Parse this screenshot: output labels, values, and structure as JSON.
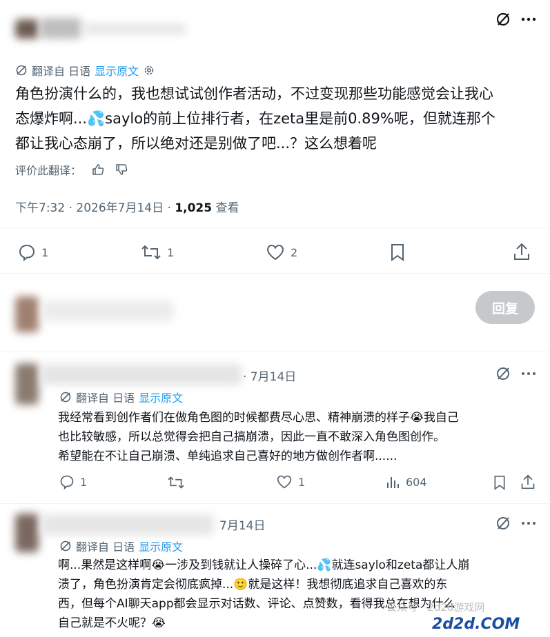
{
  "main_post": {
    "translation": {
      "label": "翻译自 日语",
      "show_original": "显示原文"
    },
    "text_lines": [
      "角色扮演什么的，我也想试试创作者活动，不过变现那些功能感觉会让我心",
      "态爆炸啊...💦saylo的前上位排行者，在zeta里是前0.89%呢，但就连那个",
      "都让我心态崩了，所以绝对还是别做了吧...？这么想着呢"
    ],
    "rate_label": "评价此翻译：",
    "timestamp": "下午7:32 · 2026年7月14日 · ",
    "views_count": "1,025",
    "views_label": " 查看",
    "actions": {
      "reply_count": "1",
      "retweet_count": "1",
      "like_count": "2"
    }
  },
  "reply_box": {
    "button_label": "回复"
  },
  "replies": [
    {
      "date": "· 7月14日",
      "translation_label": "翻译自 日语",
      "show_original": "显示原文",
      "text_lines": [
        "我经常看到创作者们在做角色图的时候都费尽心思、精神崩溃的样子😭我自己",
        "也比较敏感，所以总觉得会把自己搞崩溃，因此一直不敢深入角色图创作。",
        "希望能在不让自己崩溃、单纯追求自己喜好的地方做创作者啊......"
      ],
      "reply_count": "1",
      "like_count": "1",
      "views_count": "604"
    },
    {
      "date": "7月14日",
      "translation_label": "翻译自 日语",
      "show_original": "显示原文",
      "text_lines": [
        "啊...果然是这样啊😭一涉及到钱就让人操碎了心...💦就连saylo和zeta都让人崩",
        "溃了，角色扮演肯定会彻底疯掉...🙂就是这样！我想彻底追求自己喜欢的东",
        "西，但每个AI聊天app都会显示对话数、评论、点赞数，看得我总在想为什么",
        "自己就是不火呢？😭"
      ]
    }
  ],
  "watermark": {
    "text": "公众号 · 2d2d游戏网",
    "site": "2d2d.COM"
  }
}
